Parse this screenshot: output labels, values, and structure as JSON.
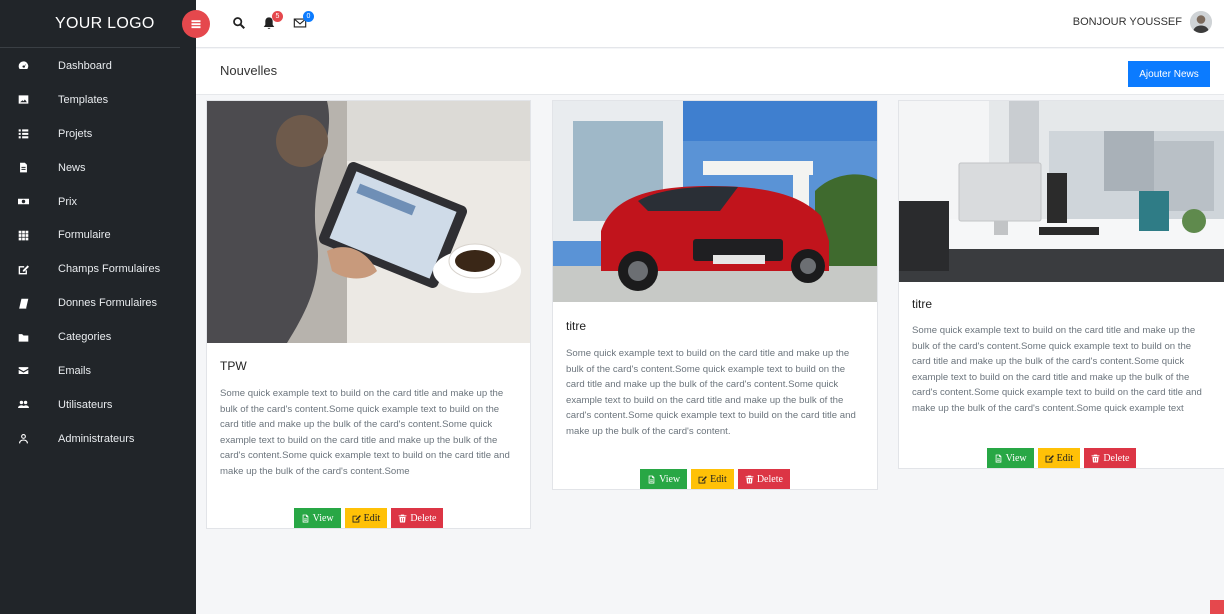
{
  "brand": {
    "logo": "YOUR LOGO"
  },
  "sidebar": {
    "items": [
      {
        "label": "Dashboard",
        "icon": "dashboard-icon"
      },
      {
        "label": "Templates",
        "icon": "image-icon"
      },
      {
        "label": "Projets",
        "icon": "list-icon"
      },
      {
        "label": "News",
        "icon": "document-icon"
      },
      {
        "label": "Prix",
        "icon": "money-icon"
      },
      {
        "label": "Formulaire",
        "icon": "grid-icon"
      },
      {
        "label": "Champs Formulaires",
        "icon": "edit-icon"
      },
      {
        "label": "Donnes Formulaires",
        "icon": "book-icon"
      },
      {
        "label": "Categories",
        "icon": "folder-icon"
      },
      {
        "label": "Emails",
        "icon": "envelope-icon"
      },
      {
        "label": "Utilisateurs",
        "icon": "users-icon"
      },
      {
        "label": "Administrateurs",
        "icon": "user-icon"
      }
    ]
  },
  "topbar": {
    "notifications_count": "5",
    "messages_count": "0",
    "greeting": "BONJOUR YOUSSEF",
    "colors": {
      "toggle": "#e5484d",
      "notif_badge": "#e5484d",
      "msg_badge": "#0b7bff"
    }
  },
  "page": {
    "title": "Nouvelles",
    "add_button": "Ajouter News"
  },
  "cards": [
    {
      "title": "TPW",
      "text": "Some quick example text to build on the card title and make up the bulk of the card's content.Some quick example text to build on the card title and make up the bulk of the card's content.Some quick example text to build on the card title and make up the bulk of the card's content.Some quick example text to build on the card title and make up the bulk of the card's content.Some",
      "image": "person-with-tablet-and-coffee"
    },
    {
      "title": "titre",
      "text": "Some quick example text to build on the card title and make up the bulk of the card's content.Some quick example text to build on the card title and make up the bulk of the card's content.Some quick example text to build on the card title and make up the bulk of the card's content.Some quick example text to build on the card title and make up the bulk of the card's content.",
      "image": "red-suv-car"
    },
    {
      "title": "titre",
      "text": "Some quick example text to build on the card title and make up the bulk of the card's content.Some quick example text to build on the card title and make up the bulk of the card's content.Some quick example text to build on the card title and make up the bulk of the card's content.Some quick example text to build on the card title and make up the bulk of the card's content.Some quick example text",
      "image": "office-desk-with-computer"
    }
  ],
  "buttons": {
    "view": "View",
    "edit": "Edit",
    "delete": "Delete"
  }
}
